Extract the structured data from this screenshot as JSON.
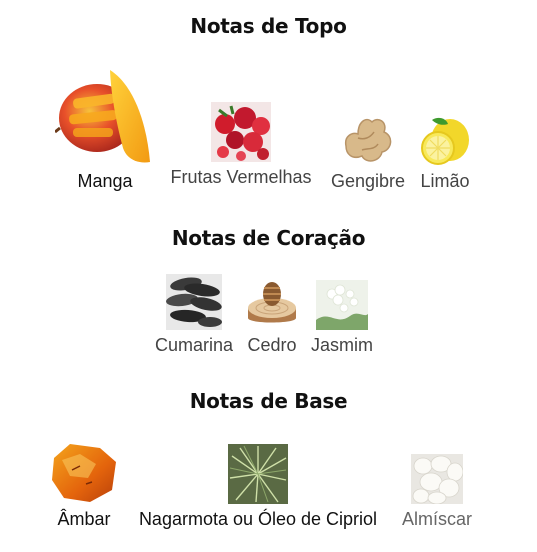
{
  "sections": {
    "top": {
      "title": "Notas de Topo",
      "notes": [
        {
          "label": "Manga",
          "icon": "mango-icon"
        },
        {
          "label": "Frutas Vermelhas",
          "icon": "red-berries-icon"
        },
        {
          "label": "Gengibre",
          "icon": "ginger-icon"
        },
        {
          "label": "Limão",
          "icon": "lemon-icon"
        }
      ]
    },
    "heart": {
      "title": "Notas de Coração",
      "notes": [
        {
          "label": "Cumarina",
          "icon": "tonka-bean-icon"
        },
        {
          "label": "Cedro",
          "icon": "cedar-wood-icon"
        },
        {
          "label": "Jasmim",
          "icon": "jasmine-icon"
        }
      ]
    },
    "base": {
      "title": "Notas de Base",
      "notes": [
        {
          "label": "Âmbar",
          "icon": "amber-icon"
        },
        {
          "label": "Nagarmota ou Óleo de Cipriol",
          "icon": "nagarmotha-plant-icon"
        },
        {
          "label": "Almíscar",
          "icon": "musk-icon"
        }
      ]
    }
  }
}
